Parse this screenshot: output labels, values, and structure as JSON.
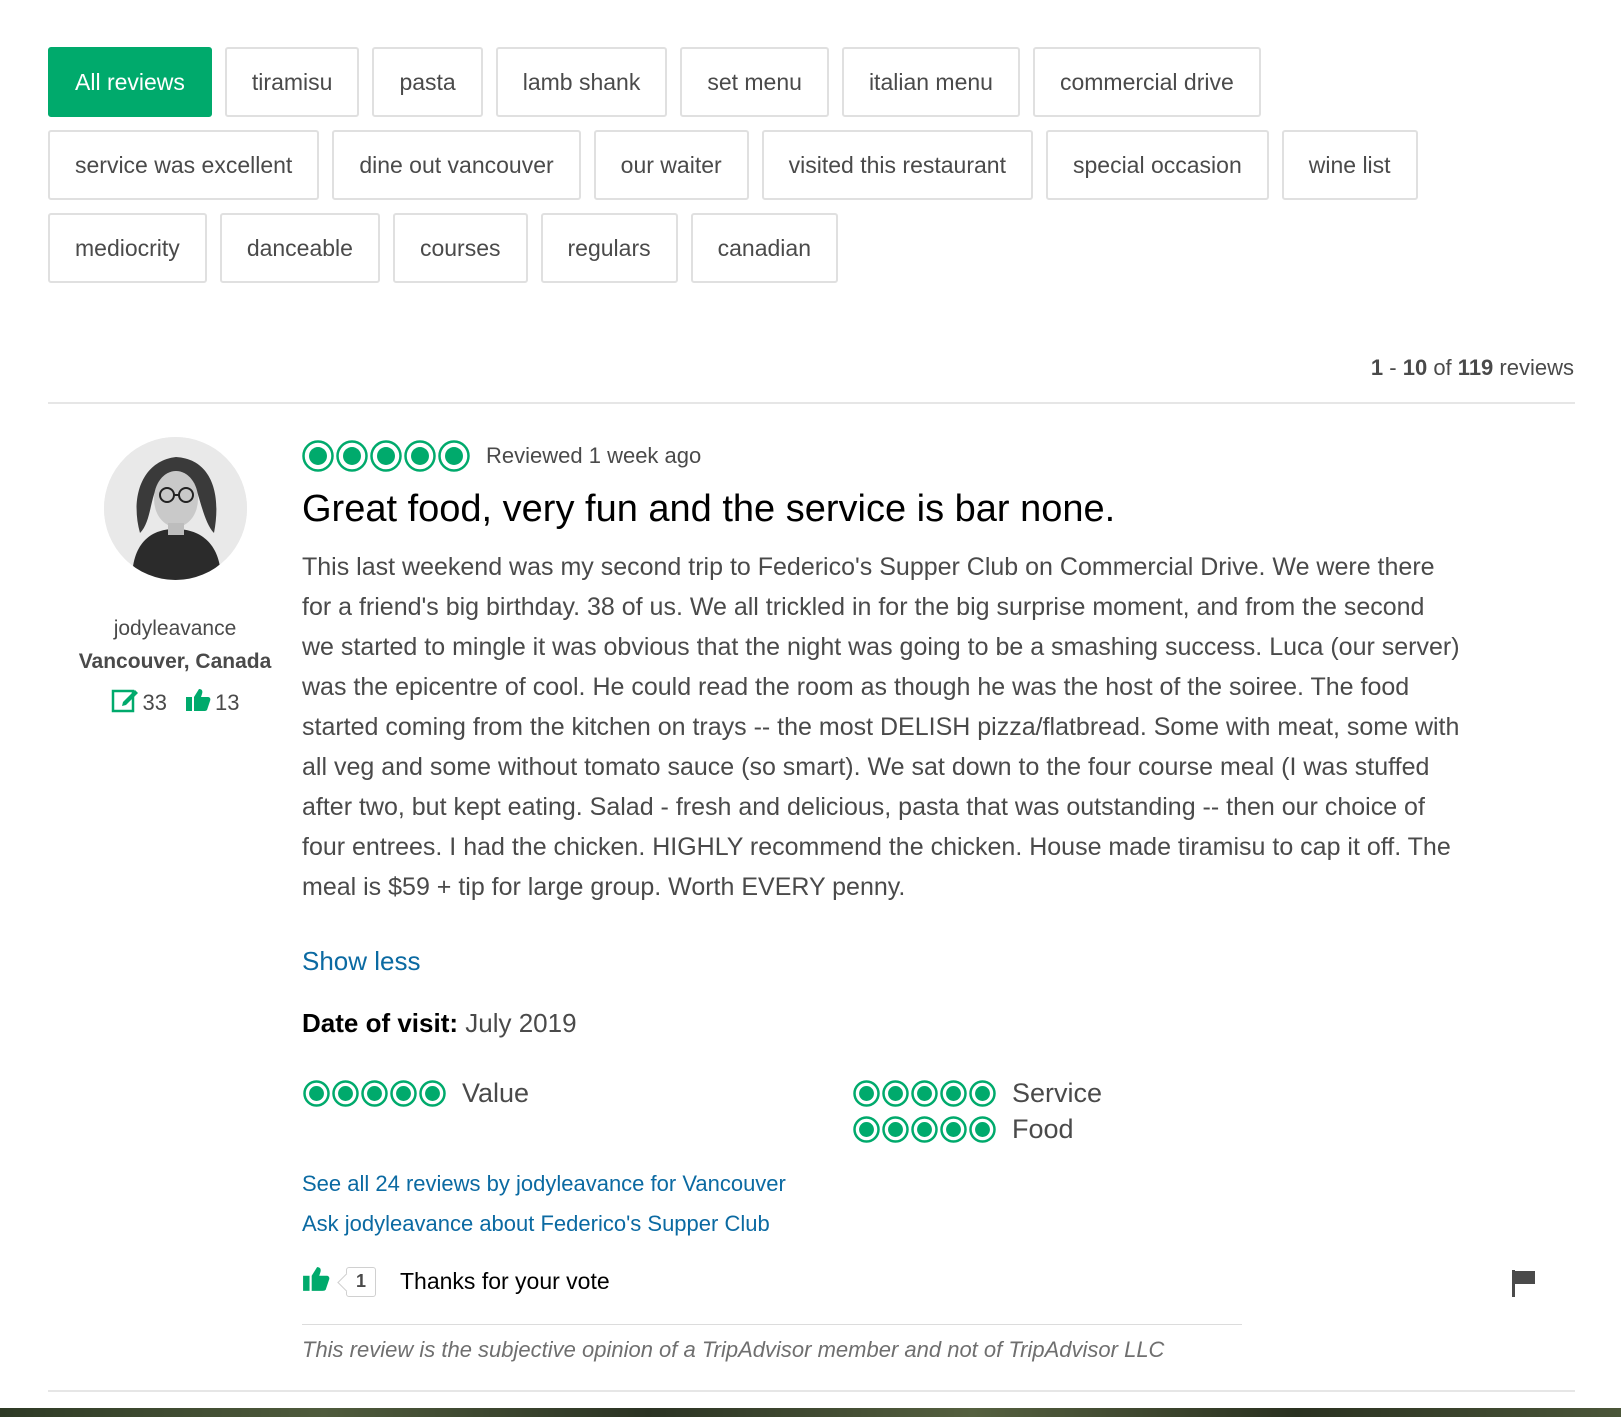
{
  "filters": [
    [
      "All reviews",
      "tiramisu",
      "pasta",
      "lamb shank",
      "set menu",
      "italian menu",
      "commercial drive"
    ],
    [
      "service was excellent",
      "dine out vancouver",
      "our waiter",
      "visited this restaurant",
      "special occasion",
      "wine list"
    ],
    [
      "mediocrity",
      "danceable",
      "courses",
      "regulars",
      "canadian"
    ]
  ],
  "active_filter": "All reviews",
  "count": {
    "from": "1",
    "to": "10",
    "total": "119",
    "of": "of",
    "label": "reviews"
  },
  "member": {
    "name": "jodyleavance",
    "location": "Vancouver, Canada",
    "reviews": "33",
    "helpful_votes": "13"
  },
  "review": {
    "rating": 5,
    "date": "Reviewed 1 week ago",
    "title": "Great food, very fun and the service is bar none.",
    "body": "This last weekend was my second trip to Federico's Supper Club on Commercial Drive. We were there for a friend's big birthday. 38 of us. We all trickled in for the big surprise moment, and from the second we started to mingle it was obvious that the night was going to be a smashing success. Luca (our server) was the epicentre of cool. He could read the room as though he was the host of the soiree. The food started coming from the kitchen on trays -- the most DELISH pizza/flatbread. Some with meat, some with all veg and some without tomato sauce (so smart). We sat down to the four course meal (I was stuffed after two, but kept eating. Salad - fresh and delicious, pasta that was outstanding -- then our choice of four entrees. I had the chicken. HIGHLY recommend the chicken. House made tiramisu to cap it off. The meal is $59 + tip for large group. Worth EVERY penny.",
    "show_less": "Show less",
    "visit_label": "Date of visit:",
    "visit_date": "July 2019",
    "subratings": [
      {
        "label": "Value",
        "rating": 5
      },
      {
        "label": "Service",
        "rating": 5
      },
      {
        "label": "Food",
        "rating": 5
      }
    ],
    "link_all": "See all 24 reviews by jodyleavance for Vancouver",
    "link_ask": "Ask jodyleavance about Federico's Supper Club",
    "vote_count": "1",
    "vote_text": "Thanks for your vote",
    "disclaimer": "This review is the subjective opinion of a TripAdvisor member and not of TripAdvisor LLC"
  },
  "icons": {
    "review_count": "pencil-note-icon",
    "helpful": "thumbs-up-icon",
    "flag": "flag-icon"
  },
  "colors": {
    "accent": "#00aa6c",
    "link": "#0b6aa2"
  }
}
